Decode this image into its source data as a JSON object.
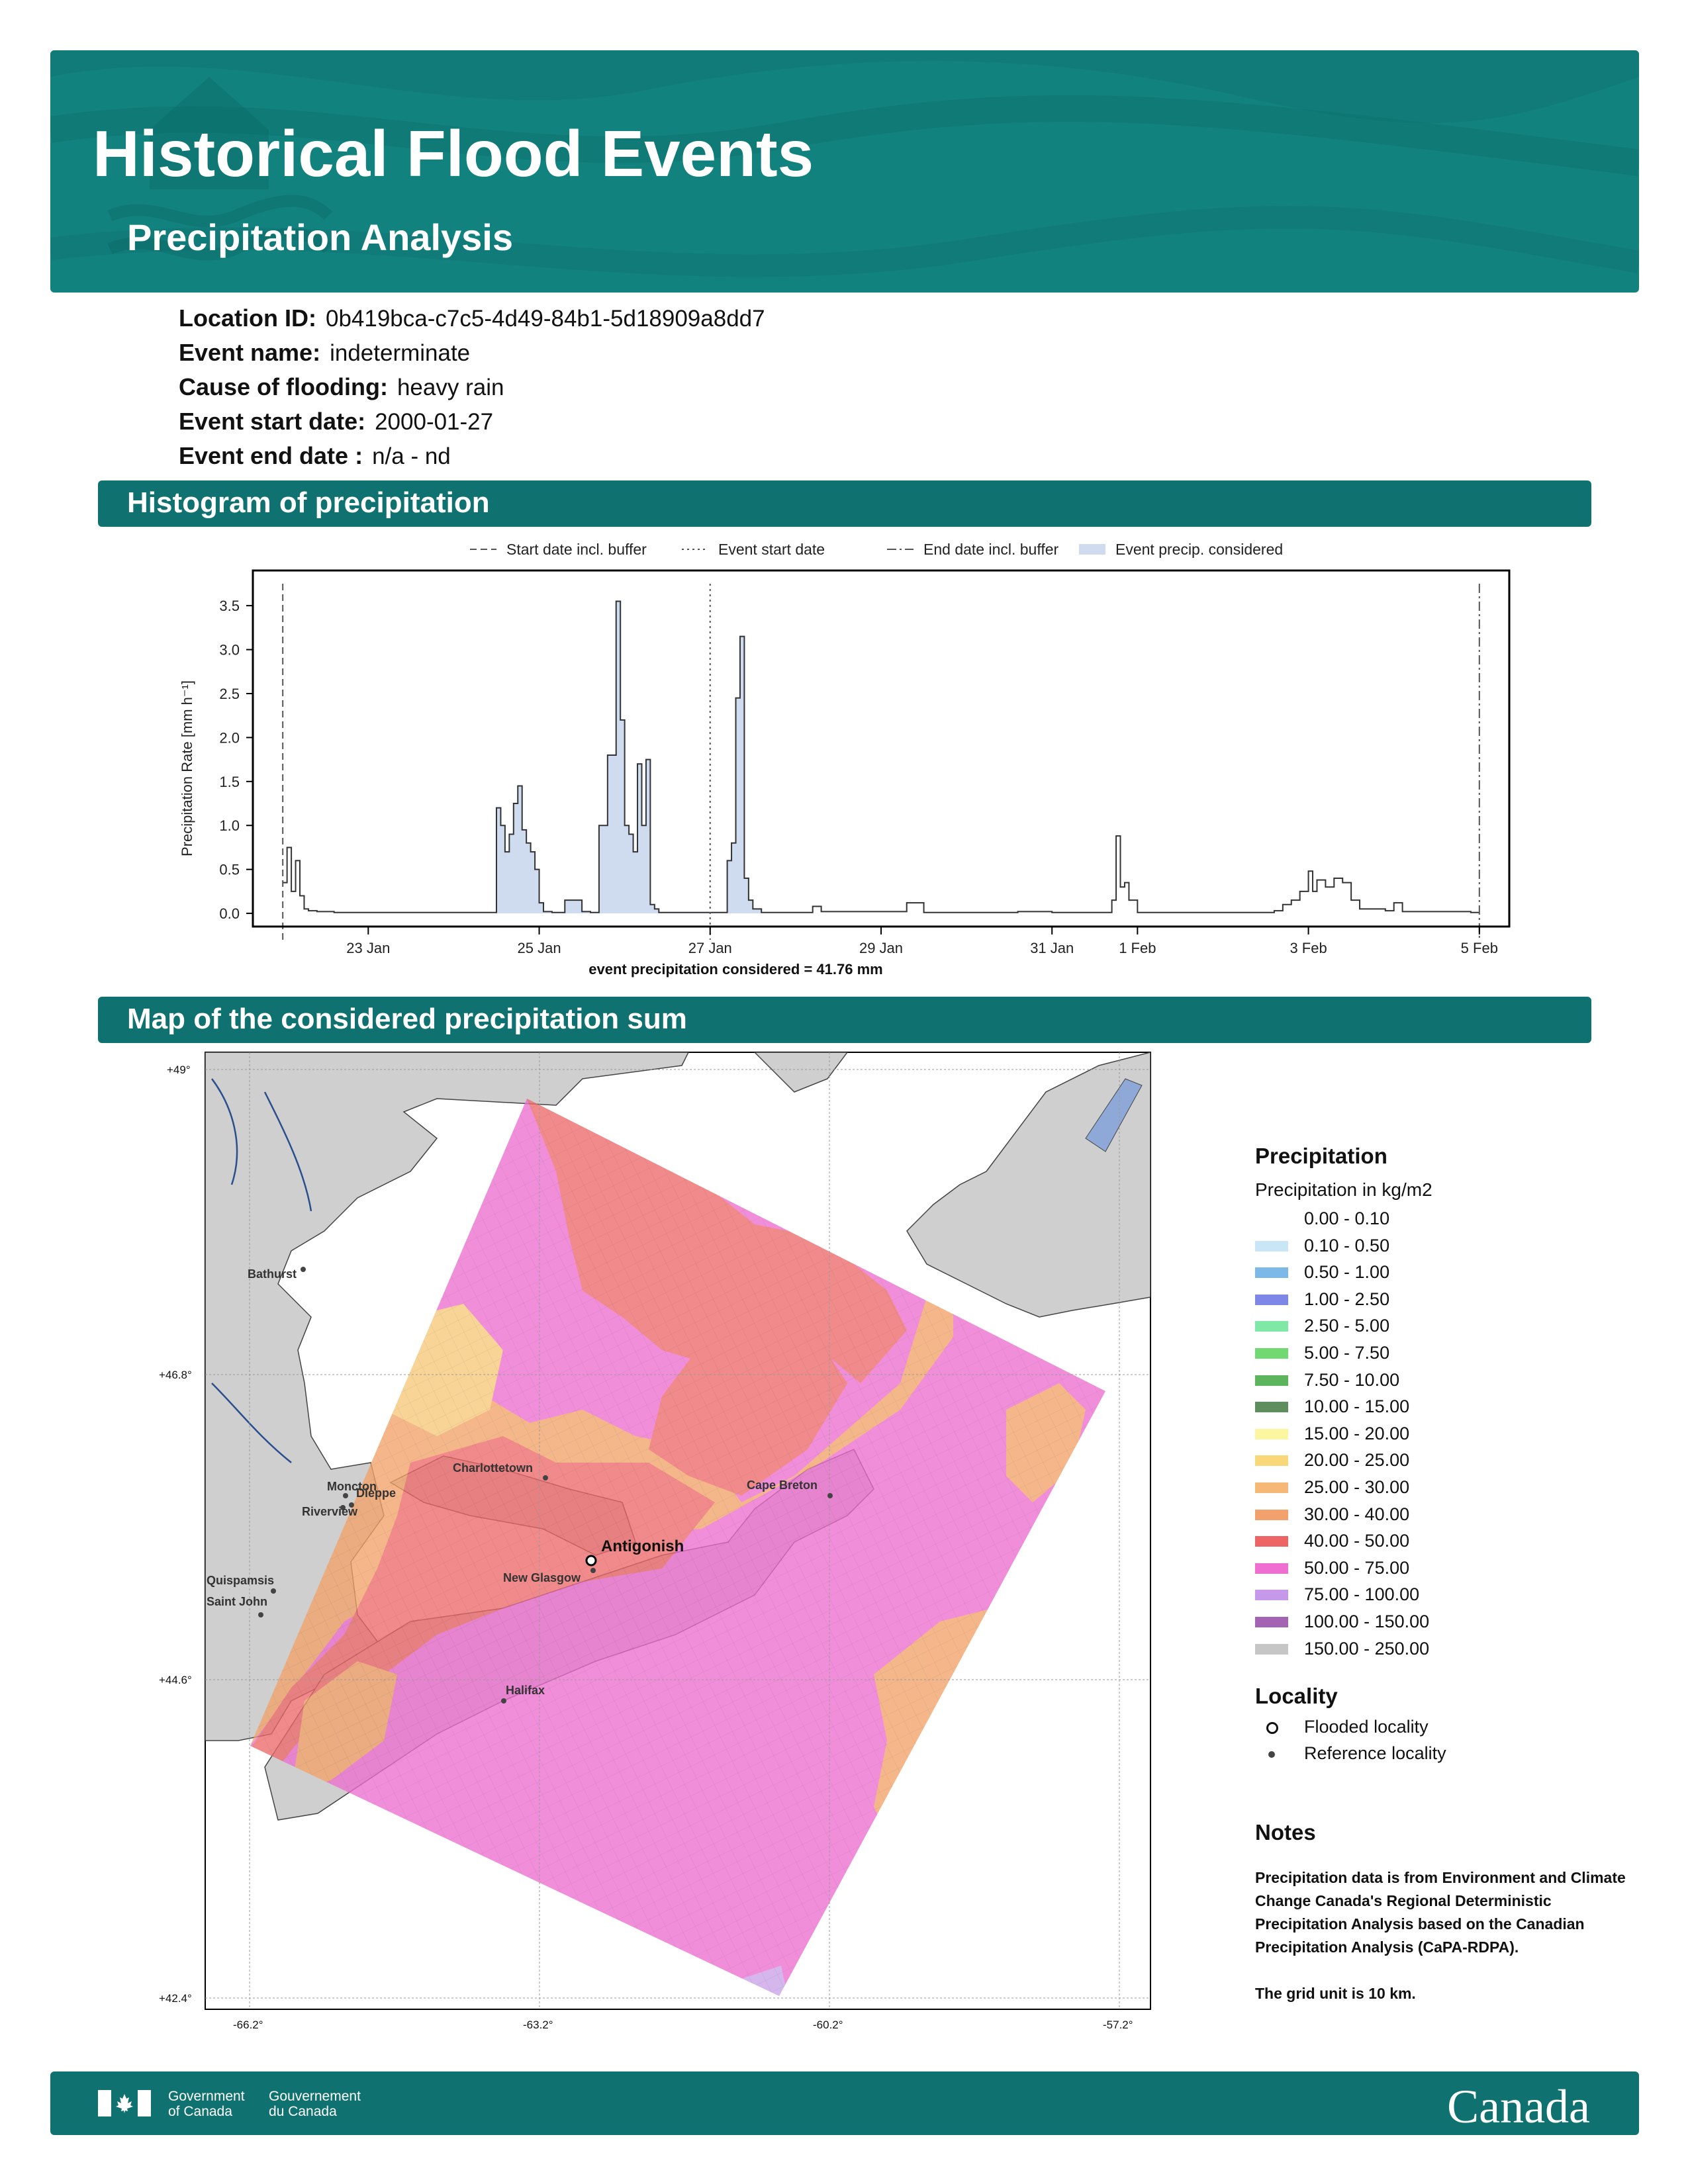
{
  "header": {
    "title": "Historical Flood Events",
    "subtitle": "Precipitation Analysis"
  },
  "meta": [
    {
      "label": "Location ID:",
      "value": "0b419bca-c7c5-4d49-84b1-5d18909a8dd7"
    },
    {
      "label": "Event name:",
      "value": "indeterminate"
    },
    {
      "label": "Cause of flooding:",
      "value": "heavy rain"
    },
    {
      "label": "Event start date:",
      "value": "2000-01-27"
    },
    {
      "label": "Event end date :",
      "value": "n/a - nd"
    }
  ],
  "sections": {
    "histogram": "Histogram of precipitation",
    "map": "Map of the considered precipitation sum"
  },
  "chart_data": {
    "type": "area",
    "ylabel": "Precipitation Rate [mm h⁻¹]",
    "xlabel": "event precipitation considered = 41.76 mm",
    "ylim": [
      -0.15,
      3.9
    ],
    "yticks": [
      "0.0",
      "0.5",
      "1.0",
      "1.5",
      "2.0",
      "2.5",
      "3.0",
      "3.5"
    ],
    "xticks": [
      {
        "label": "23 Jan",
        "day": 1
      },
      {
        "label": "25 Jan",
        "day": 3
      },
      {
        "label": "27 Jan",
        "day": 5
      },
      {
        "label": "29 Jan",
        "day": 7
      },
      {
        "label": "31 Jan",
        "day": 9
      },
      {
        "label": "1 Feb",
        "day": 10
      },
      {
        "label": "3 Feb",
        "day": 12
      },
      {
        "label": "5 Feb",
        "day": 14
      }
    ],
    "legend": [
      "Start date incl. buffer",
      "Event start date",
      "End date incl. buffer",
      "Event precip. considered"
    ],
    "vlines": {
      "start_buffer": 0,
      "event_start": 5,
      "end_buffer": 14
    },
    "fill_days": [
      2.5,
      5.6
    ],
    "series": {
      "x": [
        0,
        0.05,
        0.1,
        0.15,
        0.2,
        0.25,
        0.3,
        0.4,
        0.6,
        2.4,
        2.5,
        2.55,
        2.6,
        2.65,
        2.7,
        2.75,
        2.8,
        2.85,
        2.9,
        2.95,
        3.0,
        3.05,
        3.1,
        3.15,
        3.2,
        3.3,
        3.5,
        3.6,
        3.7,
        3.8,
        3.9,
        3.95,
        4.0,
        4.05,
        4.1,
        4.15,
        4.2,
        4.25,
        4.3,
        4.35,
        4.4,
        4.5,
        4.6,
        5.0,
        5.2,
        5.25,
        5.3,
        5.35,
        5.4,
        5.45,
        5.5,
        5.6,
        6.2,
        6.3,
        6.8,
        7.2,
        7.3,
        7.5,
        8.6,
        9.0,
        9.7,
        9.75,
        9.8,
        9.85,
        9.9,
        10.0,
        10.6,
        11.6,
        11.7,
        11.8,
        11.9,
        12.0,
        12.05,
        12.1,
        12.2,
        12.3,
        12.4,
        12.5,
        12.6,
        12.9,
        13.0,
        13.1,
        13.9,
        14.0
      ],
      "y": [
        0.35,
        0.75,
        0.25,
        0.6,
        0.2,
        0.05,
        0.03,
        0.02,
        0.01,
        0.01,
        1.2,
        1.0,
        0.7,
        0.9,
        1.25,
        1.45,
        0.95,
        0.8,
        0.7,
        0.5,
        0.12,
        0.02,
        0.02,
        0.01,
        0.01,
        0.15,
        0.02,
        0.01,
        1.0,
        1.8,
        3.55,
        2.2,
        1.0,
        0.9,
        0.7,
        1.7,
        1.0,
        1.75,
        0.1,
        0.05,
        0.01,
        0.01,
        0.01,
        0.01,
        0.6,
        0.8,
        2.45,
        3.15,
        0.4,
        0.15,
        0.05,
        0.01,
        0.08,
        0.02,
        0.02,
        0.02,
        0.12,
        0.01,
        0.02,
        0.01,
        0.15,
        0.88,
        0.3,
        0.35,
        0.15,
        0.01,
        0.01,
        0.03,
        0.1,
        0.15,
        0.25,
        0.48,
        0.25,
        0.38,
        0.3,
        0.4,
        0.35,
        0.15,
        0.05,
        0.03,
        0.12,
        0.02,
        0.01,
        0.01
      ]
    }
  },
  "map": {
    "lat_labels": [
      "+49°",
      "+46.8°",
      "+44.6°",
      "+42.4°"
    ],
    "lon_labels": [
      "-66.2°",
      "-63.2°",
      "-60.2°",
      "-57.2°"
    ],
    "places": {
      "bathurst": "Bathurst",
      "charlottetown": "Charlottetown",
      "moncton": "Moncton",
      "dieppe": "Dieppe",
      "riverview": "Riverview",
      "cape_breton": "Cape Breton",
      "antigonish": "Antigonish",
      "new_glasgow": "New Glasgow",
      "quispamsis": "Quispamsis",
      "saint_john": "Saint John",
      "halifax": "Halifax"
    },
    "colors": {
      "orange": "#f2a36a",
      "red": "#ee6a6a",
      "magenta": "#ee6fd0",
      "yellow": "#f6c97a",
      "violet": "#c9a2e8",
      "land": "#cfcfcf"
    }
  },
  "legend": {
    "title": "Precipitation",
    "subtitle": "Precipitation in kg/m2",
    "items": [
      {
        "label": "0.00 - 0.10",
        "color": "#ffffff"
      },
      {
        "label": "0.10 - 0.50",
        "color": "#c9e6f6"
      },
      {
        "label": "0.50 - 1.00",
        "color": "#7db9e8"
      },
      {
        "label": "1.00 - 2.50",
        "color": "#7e87e6"
      },
      {
        "label": "2.50 - 5.00",
        "color": "#7fe8a6"
      },
      {
        "label": "5.00 - 7.50",
        "color": "#72d872"
      },
      {
        "label": "7.50 - 10.00",
        "color": "#5cb45c"
      },
      {
        "label": "10.00 - 15.00",
        "color": "#5e8d5e"
      },
      {
        "label": "15.00 - 20.00",
        "color": "#fcf6a0"
      },
      {
        "label": "20.00 - 25.00",
        "color": "#f9d87a"
      },
      {
        "label": "25.00 - 30.00",
        "color": "#f6b877"
      },
      {
        "label": "30.00 - 40.00",
        "color": "#f2a06c"
      },
      {
        "label": "40.00 - 50.00",
        "color": "#ec6464"
      },
      {
        "label": "50.00 - 75.00",
        "color": "#ee6fd0"
      },
      {
        "label": "75.00 - 100.00",
        "color": "#c698ea"
      },
      {
        "label": "100.00 - 150.00",
        "color": "#a364b4"
      },
      {
        "label": "150.00 - 250.00",
        "color": "#c6c6c6"
      }
    ],
    "locality_title": "Locality",
    "flooded": "Flooded locality",
    "reference": "Reference locality"
  },
  "notes": {
    "title": "Notes",
    "text": "Precipitation data is from Environment and Climate Change Canada's Regional Deterministic Precipitation Analysis based on the Canadian Precipitation Analysis (CaPA-RDPA).",
    "grid": "The grid unit is 10 km."
  },
  "footer": {
    "gov_en_1": "Government",
    "gov_en_2": "of Canada",
    "gov_fr_1": "Gouvernement",
    "gov_fr_2": "du Canada",
    "wordmark": "Canada"
  }
}
